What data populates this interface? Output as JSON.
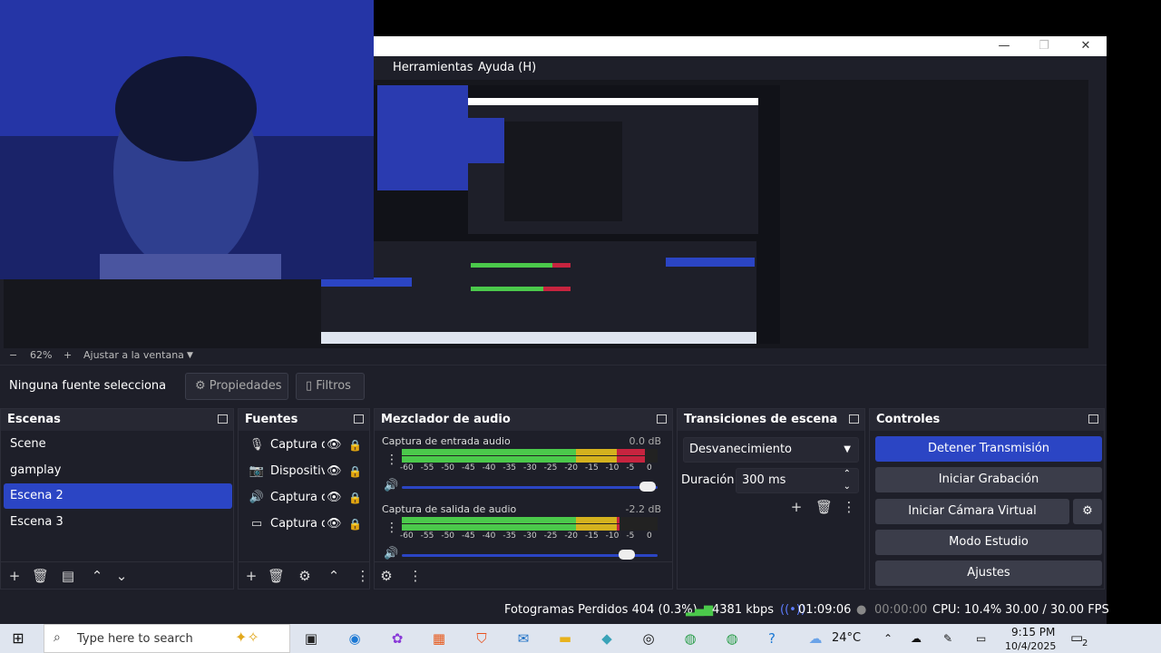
{
  "window": {
    "menu": [
      "Herramientas",
      "Ayuda (H)"
    ],
    "controls": [
      "minimize",
      "maximize",
      "close"
    ]
  },
  "preview": {
    "zoom": "62%",
    "fit_label": "Ajustar a la ventana",
    "zoom_minus": "−",
    "zoom_plus": "+"
  },
  "source_toolbar": {
    "label": "Ninguna fuente selecciona",
    "properties": "Propiedades",
    "filters": "Filtros"
  },
  "docks": {
    "scenes": {
      "title": "Escenas",
      "items": [
        "Scene",
        "gamplay",
        "Escena 2",
        "Escena 3"
      ],
      "active_index": 2
    },
    "sources": {
      "title": "Fuentes",
      "items": [
        {
          "name": "Captura d",
          "icon": "microphone-icon"
        },
        {
          "name": "Dispositiv",
          "icon": "camera-icon"
        },
        {
          "name": "Captura d",
          "icon": "speaker-icon"
        },
        {
          "name": "Captura d",
          "icon": "monitor-icon"
        }
      ]
    },
    "mixer": {
      "title": "Mezclador de audio",
      "channels": [
        {
          "name": "Captura de entrada audio",
          "db": "0.0 dB",
          "level_fraction": 0.95,
          "fader_fraction": 0.96
        },
        {
          "name": "Captura de salida de audio",
          "db": "-2.2 dB",
          "level_fraction": 0.85,
          "fader_fraction": 0.88
        }
      ],
      "scale": [
        "-60",
        "-55",
        "-50",
        "-45",
        "-40",
        "-35",
        "-30",
        "-25",
        "-20",
        "-15",
        "-10",
        "-5",
        "0"
      ]
    },
    "transitions": {
      "title": "Transiciones de escena",
      "selected": "Desvanecimiento",
      "duration_label": "Duración",
      "duration_value": "300 ms"
    },
    "controls": {
      "title": "Controles",
      "stop_stream": "Detener Transmisión",
      "start_recording": "Iniciar Grabación",
      "start_virtual_cam": "Iniciar Cámara Virtual",
      "studio_mode": "Modo Estudio",
      "settings": "Ajustes"
    }
  },
  "statusbar": {
    "dropped_frames": "Fotogramas Perdidos 404 (0.3%)",
    "bitrate": "4381 kbps",
    "stream_time": "01:09:06",
    "record_time": "00:00:00",
    "cpu": "CPU: 10.4%",
    "fps": "30.00 / 30.00 FPS"
  },
  "taskbar": {
    "search_placeholder": "Type here to search",
    "weather": "24°C",
    "time": "9:15 PM",
    "date": "10/4/2025",
    "notifications": "2"
  },
  "colors": {
    "accent": "#2b45c4",
    "meter_green": "#4bc94b",
    "meter_yellow": "#d4b21e",
    "meter_red": "#c7243f",
    "panel": "#1e1f29"
  }
}
